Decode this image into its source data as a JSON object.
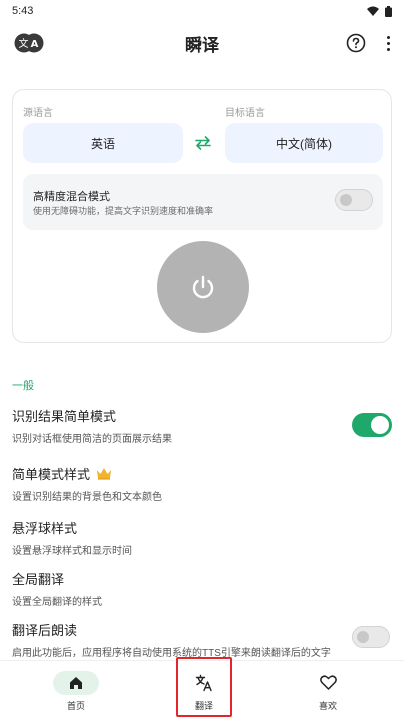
{
  "status_bar": {
    "time": "5:43"
  },
  "header": {
    "title": "瞬译",
    "logo_text": "文A"
  },
  "card": {
    "source_label": "源语言",
    "target_label": "目标语言",
    "source_lang": "英语",
    "target_lang": "中文(简体)",
    "mix_mode": {
      "title": "高精度混合模式",
      "desc": "使用无障碍功能，提高文字识别速度和准确率",
      "enabled": false
    }
  },
  "section": {
    "general": "一般"
  },
  "settings": [
    {
      "title": "识别结果简单模式",
      "desc": "识别对话框使用简洁的页面展示结果",
      "enabled": true
    },
    {
      "title": "简单模式样式",
      "desc": "设置识别结果的背景色和文本颜色",
      "premium": true
    },
    {
      "title": "悬浮球样式",
      "desc": "设置悬浮球样式和显示时间"
    },
    {
      "title": "全局翻译",
      "desc": "设置全局翻译的样式"
    },
    {
      "title": "翻译后朗读",
      "desc": "启用此功能后，应用程序将自动使用系统的TTS引擎来朗读翻译后的文字",
      "enabled": false
    }
  ],
  "nav": {
    "home": "首页",
    "translate": "翻译",
    "favorites": "喜欢"
  },
  "colors": {
    "accent": "#1ea96b",
    "highlight": "#e3262b"
  }
}
